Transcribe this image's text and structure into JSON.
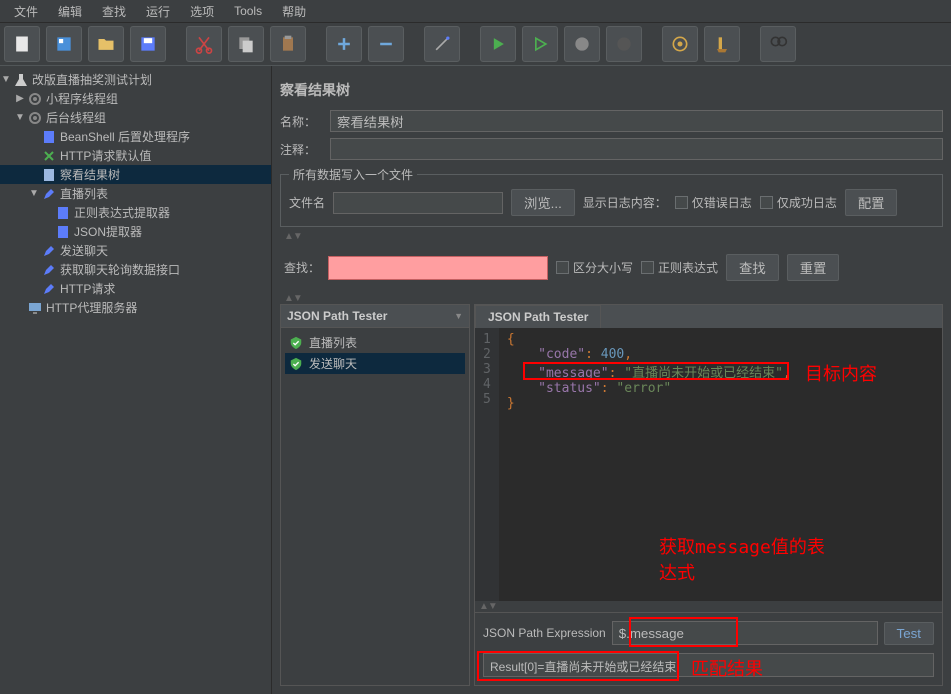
{
  "menubar": [
    "文件",
    "编辑",
    "查找",
    "运行",
    "选项",
    "Tools",
    "帮助"
  ],
  "toolbar_icons": [
    "new-doc",
    "template",
    "open",
    "save",
    "scissors",
    "copy",
    "paste",
    "plus",
    "minus",
    "wand",
    "play-green",
    "play-outline",
    "stop-grey",
    "stop-dark",
    "gear1",
    "broom",
    "binoculars"
  ],
  "tree": {
    "root": "改版直播抽奖测试计划",
    "items": [
      {
        "label": "小程序线程组",
        "icon": "gear",
        "indent": 1
      },
      {
        "label": "后台线程组",
        "icon": "gear",
        "indent": 1,
        "expanded": true
      },
      {
        "label": "BeanShell 后置处理程序",
        "icon": "doc",
        "indent": 2
      },
      {
        "label": "HTTP请求默认值",
        "icon": "pin",
        "indent": 2
      },
      {
        "label": "察看结果树",
        "icon": "doc-blue",
        "indent": 2,
        "selected": true
      },
      {
        "label": "直播列表",
        "icon": "pen",
        "indent": 2,
        "expanded": true
      },
      {
        "label": "正则表达式提取器",
        "icon": "doc",
        "indent": 3
      },
      {
        "label": "JSON提取器",
        "icon": "doc",
        "indent": 3
      },
      {
        "label": "发送聊天",
        "icon": "pen",
        "indent": 2
      },
      {
        "label": "获取聊天轮询数据接口",
        "icon": "pen",
        "indent": 2
      },
      {
        "label": "HTTP请求",
        "icon": "pen",
        "indent": 2
      },
      {
        "label": "HTTP代理服务器",
        "icon": "monitor",
        "indent": 1
      }
    ]
  },
  "panel": {
    "title": "察看结果树",
    "name_label": "名称：",
    "name_value": "察看结果树",
    "comment_label": "注释：",
    "file_legend": "所有数据写入一个文件",
    "filename_label": "文件名",
    "browse_btn": "浏览...",
    "log_label": "显示日志内容：",
    "error_only": "仅错误日志",
    "success_only": "仅成功日志",
    "config_btn": "配置",
    "search_label": "查找：",
    "case_sensitive": "区分大小写",
    "regex": "正则表达式",
    "search_btn": "查找",
    "reset_btn": "重置"
  },
  "tester": {
    "left_header": "JSON Path Tester",
    "right_tab": "JSON Path Tester",
    "results": [
      {
        "label": "直播列表"
      },
      {
        "label": "发送聊天",
        "selected": true
      }
    ],
    "expression_label": "JSON Path Expression",
    "expression_value": "$.message",
    "test_btn": "Test",
    "result_text": "Result[0]=直播尚未开始或已经结束"
  },
  "chart_data": {
    "type": "table",
    "json_response": {
      "code": 400,
      "message": "直播尚未开始或已经结束",
      "status": "error"
    },
    "highlighted_line": 3
  },
  "code": {
    "line1": "{",
    "line2_key": "\"code\"",
    "line2_val": "400",
    "line3_key": "\"message\"",
    "line3_val": "\"直播尚未开始或已经结束\"",
    "line4_key": "\"status\"",
    "line4_val": "\"error\"",
    "line5": "}"
  },
  "annotations": {
    "target": "目标内容",
    "expr": "获取message值的表\n达式",
    "match": "匹配结果"
  }
}
